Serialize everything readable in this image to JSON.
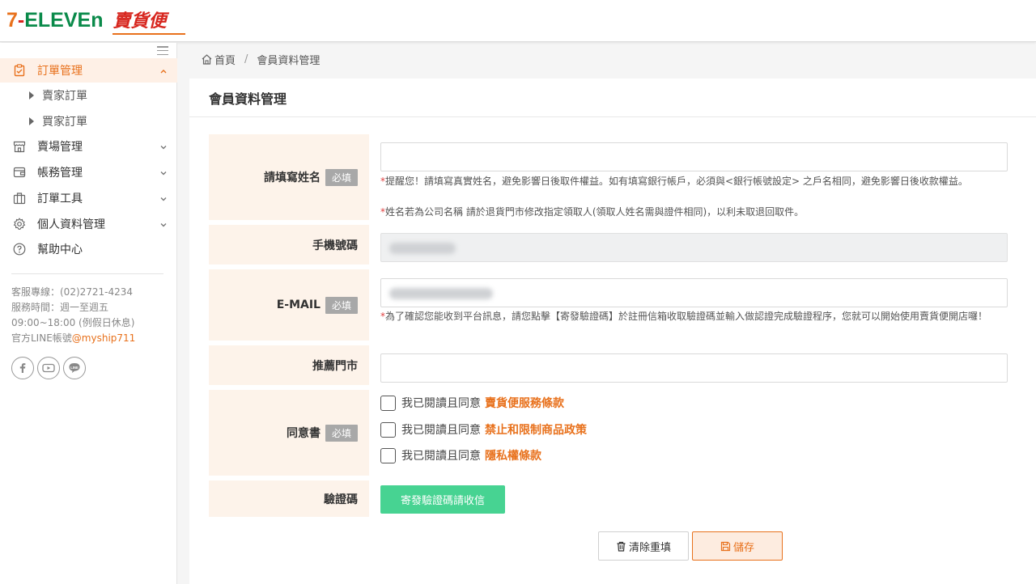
{
  "header": {
    "logo_parts": [
      "7",
      "-",
      "ELEVEn"
    ],
    "logo_sub": "賣貨便"
  },
  "colors": {
    "accent": "#e8711c",
    "active_bg": "#fef0e6",
    "label_bg": "#fdf3ea",
    "green_button": "#47d392",
    "required_badge": "#a8a8a8"
  },
  "sidebar": {
    "menu": [
      {
        "label": "訂單管理",
        "icon": "clipboard-check-icon",
        "expanded": true,
        "active": true
      },
      {
        "label": "賣場管理",
        "icon": "store-icon"
      },
      {
        "label": "帳務管理",
        "icon": "wallet-icon"
      },
      {
        "label": "訂單工具",
        "icon": "briefcase-icon"
      },
      {
        "label": "個人資料管理",
        "icon": "gear-icon"
      },
      {
        "label": "幫助中心",
        "icon": "question-circle-icon"
      }
    ],
    "submenu": [
      "賣家訂單",
      "買家訂單"
    ],
    "info": {
      "hotline": "客服專線：(02)2721-4234",
      "hours": "服務時間：週一至週五",
      "hours_detail": "09:00~18:00 (例假日休息)",
      "line_prefix": "官方LINE帳號",
      "line_handle": "@myship711"
    },
    "socials": [
      "facebook-icon",
      "youtube-icon",
      "line-icon"
    ]
  },
  "breadcrumb": {
    "home": "首頁",
    "separator": "/",
    "current": "會員資料管理"
  },
  "page": {
    "title": "會員資料管理",
    "required_label": "必填",
    "fields": {
      "name": {
        "label": "請填寫姓名",
        "value": "",
        "note1": "提醒您！請填寫真實姓名，避免影響日後取件權益。如有填寫銀行帳戶，必須與<銀行帳號設定> 之戶名相同，避免影響日後收款權益。",
        "note2": "姓名若為公司名稱 請於退貨門市修改指定領取人(領取人姓名需與證件相同)，以利未取退回取件。"
      },
      "phone": {
        "label": "手機號碼"
      },
      "email": {
        "label": "E-MAIL",
        "note": "為了確認您能收到平台訊息，請您點擊【寄發驗證碼】於註冊信箱收取驗證碼並輸入做認證完成驗證程序，您就可以開始使用賣貨便開店囉！"
      },
      "store": {
        "label": "推薦門市",
        "value": ""
      },
      "consent": {
        "label": "同意書",
        "prefix": "我已閱讀且同意",
        "items": [
          {
            "link": "賣貨便服務條款",
            "checked": false
          },
          {
            "link": "禁止和限制商品政策",
            "checked": false
          },
          {
            "link": "隱私權條款",
            "checked": false
          }
        ]
      },
      "verify": {
        "label": "驗證碼",
        "button": "寄發驗證碼請收信"
      }
    },
    "buttons": {
      "clear": "清除重填",
      "save": "儲存"
    }
  }
}
